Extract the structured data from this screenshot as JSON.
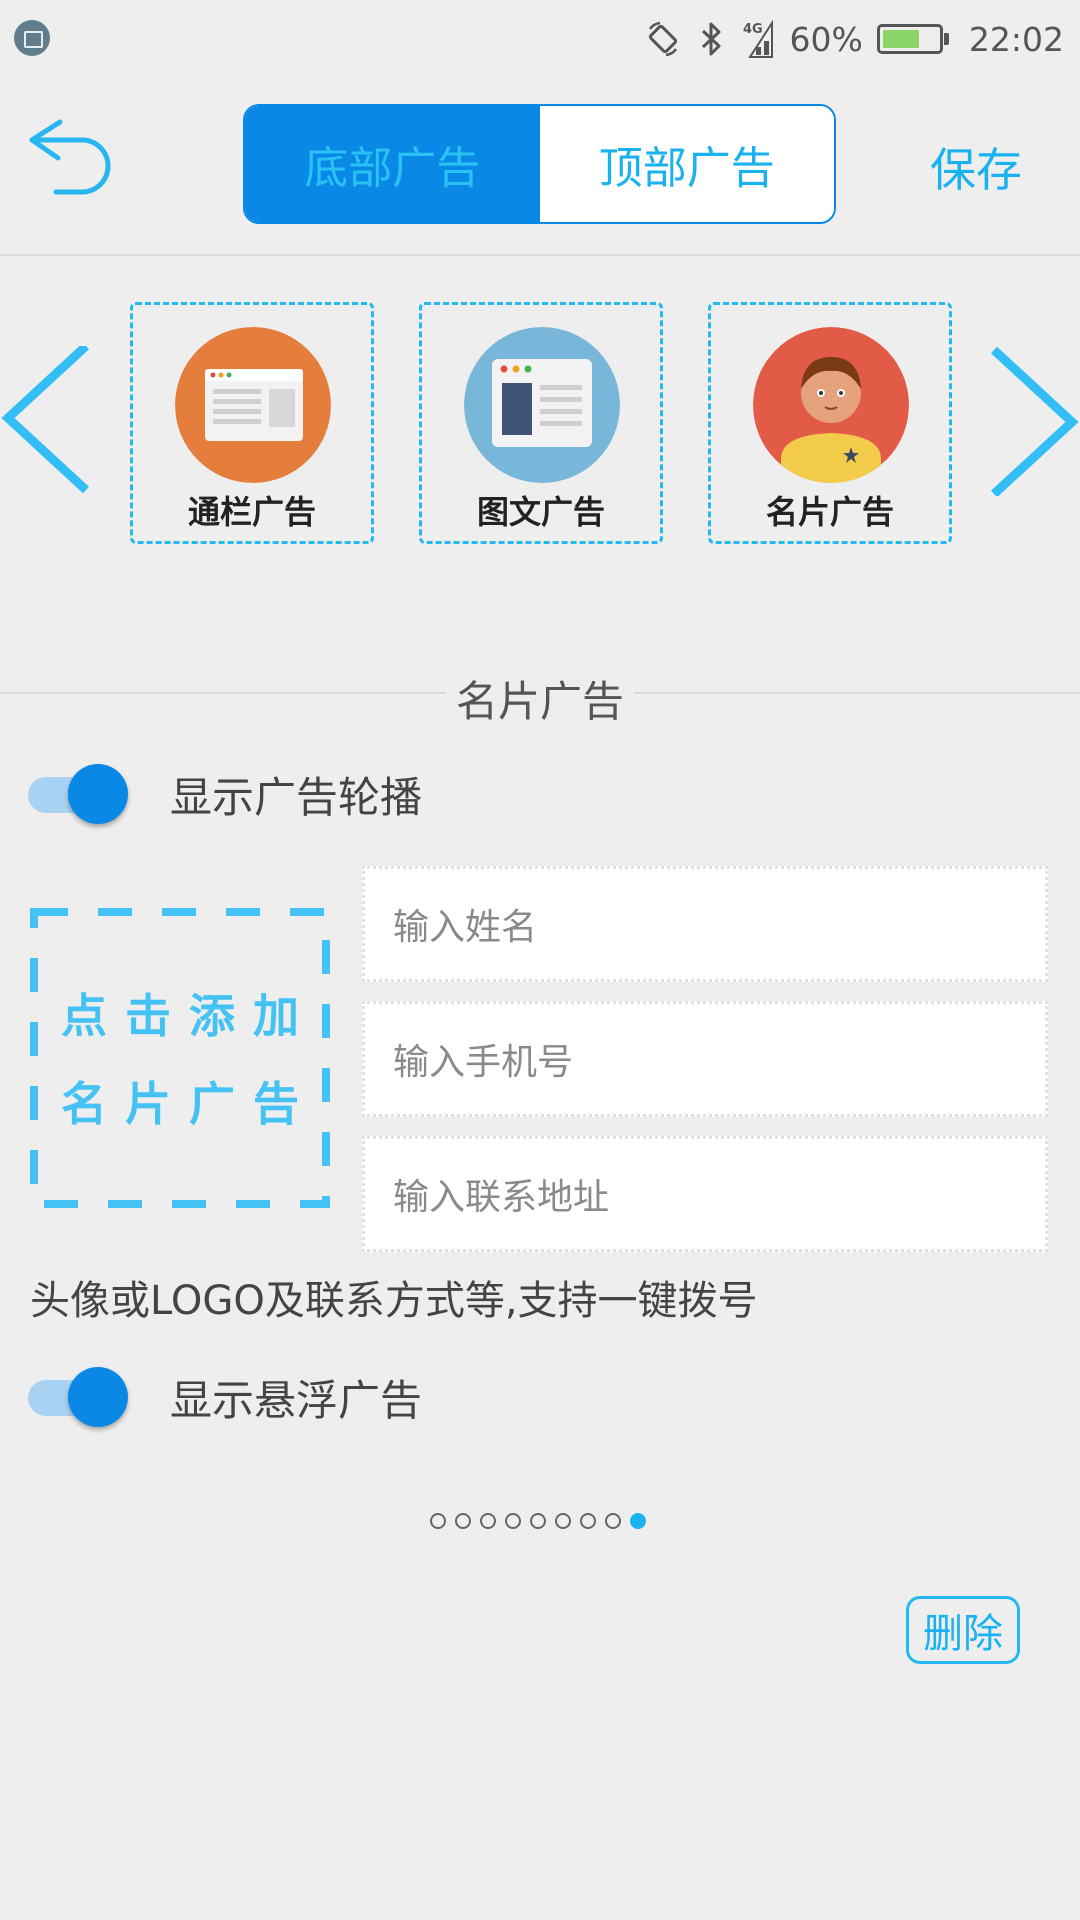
{
  "status_bar": {
    "battery_percent": "60%",
    "time": "22:02",
    "network_label": "4G",
    "icons": [
      "screenshot-app-icon",
      "rotation-lock-icon",
      "bluetooth-icon",
      "signal-icon",
      "battery-icon"
    ]
  },
  "header": {
    "tabs": [
      {
        "label": "底部广告",
        "active": true
      },
      {
        "label": "顶部广告",
        "active": false
      }
    ],
    "save_label": "保存",
    "back_icon": "back-arrow-icon"
  },
  "ad_types": [
    {
      "label": "通栏广告",
      "icon": "banner-ad-icon",
      "color": "#e57d3c"
    },
    {
      "label": "图文广告",
      "icon": "image-text-ad-icon",
      "color": "#78b6da"
    },
    {
      "label": "名片广告",
      "icon": "business-card-ad-icon",
      "color": "#e25b47"
    }
  ],
  "section_title": "名片广告",
  "toggles": {
    "carousel_label": "显示广告轮播",
    "carousel_on": true,
    "floating_label": "显示悬浮广告",
    "floating_on": true
  },
  "card_form": {
    "add_line1": "点击添加",
    "add_line2": "名片广告",
    "name_placeholder": "输入姓名",
    "phone_placeholder": "输入手机号",
    "address_placeholder": "输入联系地址",
    "hint": "头像或LOGO及联系方式等,支持一键拨号"
  },
  "pager": {
    "total": 9,
    "current": 9
  },
  "delete_label": "删除",
  "colors": {
    "primary": "#0a88e6",
    "accent": "#1ab1ef",
    "background": "#eeeeee"
  }
}
